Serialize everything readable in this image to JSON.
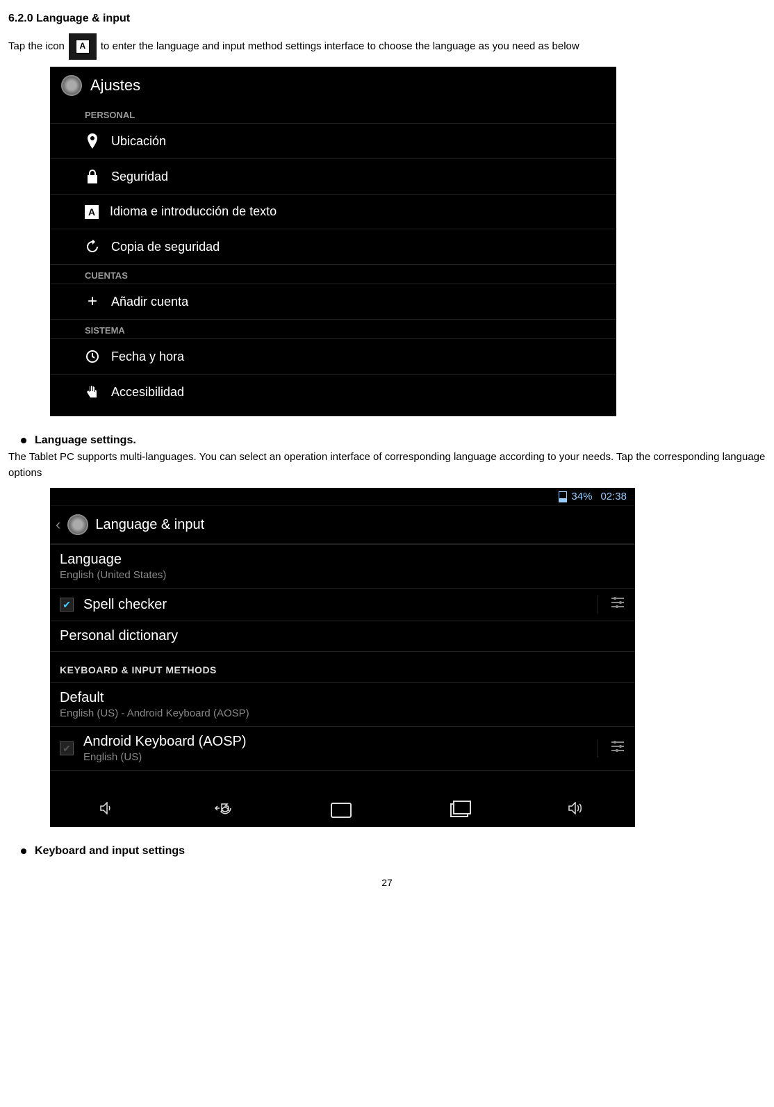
{
  "section_number": "6.2.0 Language & input",
  "intro_prefix": "Tap the icon",
  "intro_suffix": " to enter the language and input method settings interface to choose the language as you need as below",
  "inline_icon_letter": "A",
  "screenshot1": {
    "header_title": "Ajustes",
    "cat_personal": "PERSONAL",
    "row_location": "Ubicación",
    "row_security": "Seguridad",
    "row_language": "Idioma e introducción de texto",
    "row_language_icon_letter": "A",
    "row_backup": "Copia de seguridad",
    "cat_accounts": "CUENTAS",
    "row_add_account": "Añadir cuenta",
    "cat_system": "SISTEMA",
    "row_datetime": "Fecha y hora",
    "row_accessibility": "Accesibilidad"
  },
  "bullet1_title": "Language settings.",
  "bullet1_para": "The Tablet PC supports multi-languages. You can select an operation interface of corresponding language according to your needs. Tap the corresponding language options",
  "screenshot2": {
    "battery_pct": "34%",
    "clock": "02:38",
    "header_title": "Language & input",
    "row_language_title": "Language",
    "row_language_sub": "English (United States)",
    "row_spell_title": "Spell checker",
    "row_personal_dict": "Personal dictionary",
    "kb_header": "KEYBOARD & INPUT METHODS",
    "row_default_title": "Default",
    "row_default_sub": "English (US) - Android Keyboard (AOSP)",
    "row_android_kb_title": "Android Keyboard (AOSP)",
    "row_android_kb_sub": "English (US)"
  },
  "bullet2_title": "Keyboard and input settings",
  "page_number": "27"
}
